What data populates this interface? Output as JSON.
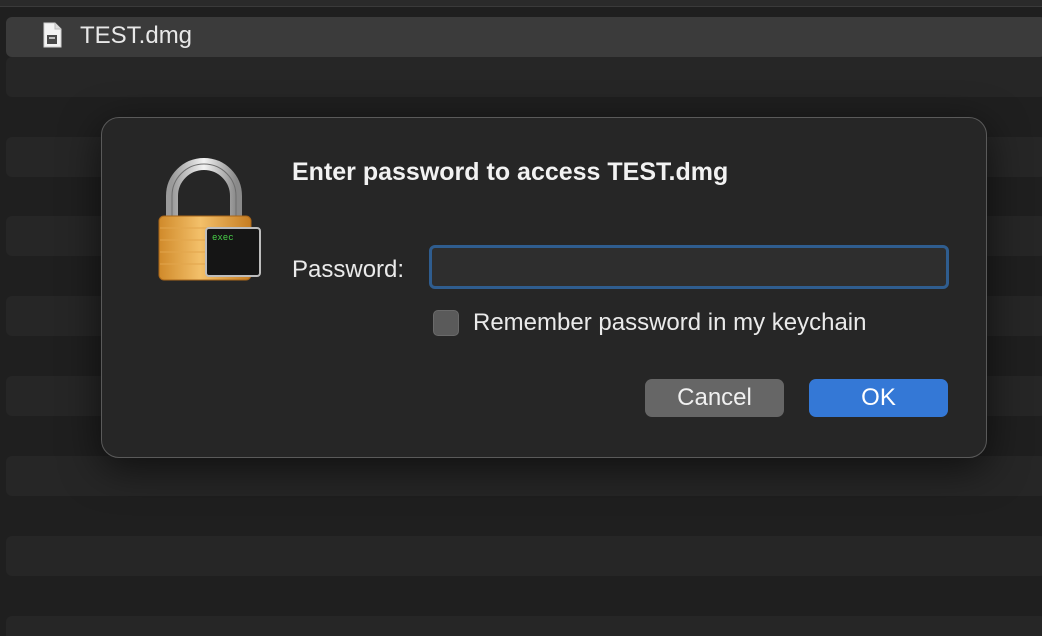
{
  "file_list": {
    "selected_file": "TEST.dmg",
    "file_icon": "disk-image-file-icon"
  },
  "dialog": {
    "icon": "lock-exec-icon",
    "icon_badge_text": "exec",
    "title": "Enter password to access TEST.dmg",
    "password_label": "Password:",
    "password_value": "",
    "remember_label": "Remember password in my keychain",
    "remember_checked": false,
    "cancel_label": "Cancel",
    "ok_label": "OK"
  },
  "colors": {
    "accent": "#3478d6",
    "background": "#1f1f1f",
    "dialog_bg": "#262626"
  }
}
